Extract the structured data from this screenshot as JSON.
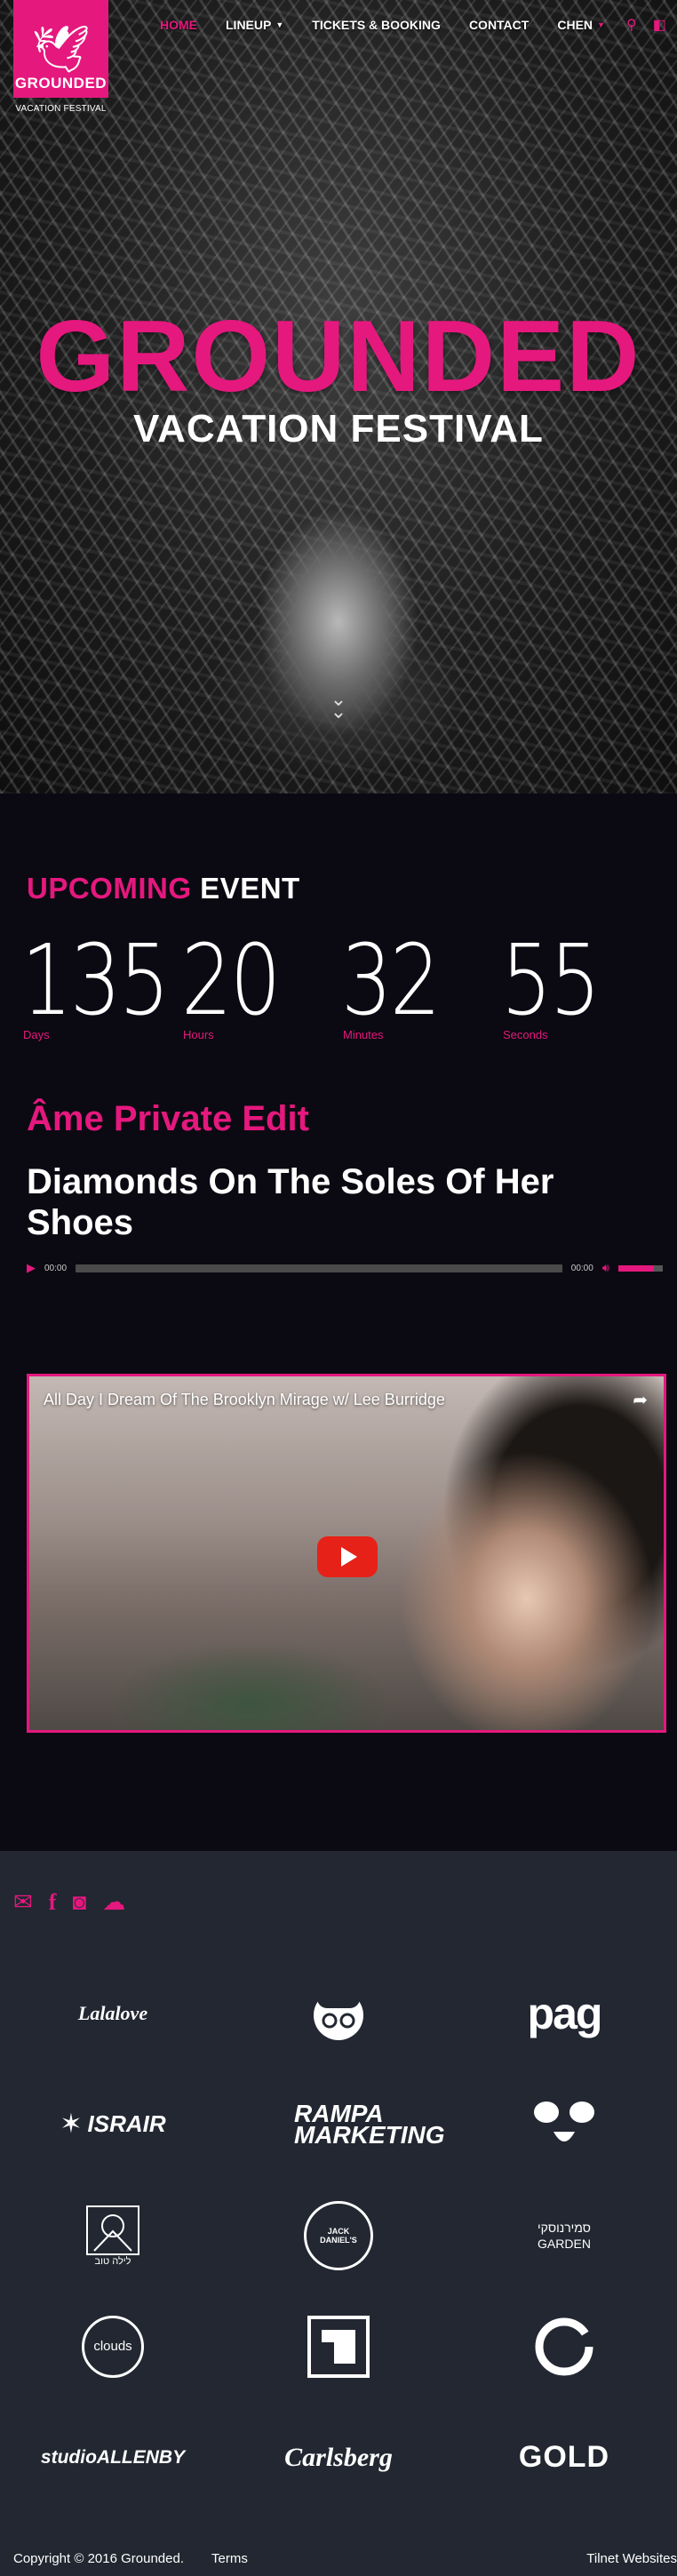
{
  "logo": {
    "text": "GROUNDED",
    "tagline": "VACATION FESTIVAL"
  },
  "nav": {
    "items": [
      {
        "label": "HOME",
        "active": true,
        "dropdown": false
      },
      {
        "label": "LINEUP",
        "active": false,
        "dropdown": true
      },
      {
        "label": "TICKETS & BOOKING",
        "active": false,
        "dropdown": false
      },
      {
        "label": "CONTACT",
        "active": false,
        "dropdown": false
      },
      {
        "label": "CHEN",
        "active": false,
        "dropdown": true
      }
    ],
    "icons": [
      "search-icon",
      "cart-icon"
    ]
  },
  "hero": {
    "title": "GROUNDED",
    "subtitle": "VACATION FESTIVAL"
  },
  "event": {
    "heading_highlight": "UPCOMING",
    "heading_rest": "EVENT",
    "countdown": [
      {
        "value": "135",
        "label": "Days"
      },
      {
        "value": "20",
        "label": "Hours"
      },
      {
        "value": "32",
        "label": "Minutes"
      },
      {
        "value": "55",
        "label": "Seconds"
      }
    ],
    "track_artist": "Âme Private Edit",
    "track_title": "Diamonds On The Soles Of Her Shoes",
    "player": {
      "current_time": "00:00",
      "duration": "00:00",
      "volume": 0.8
    }
  },
  "video": {
    "title": "All Day I Dream Of The Brooklyn Mirage w/ Lee Burridge"
  },
  "footer": {
    "social_icons": [
      "mail-icon",
      "facebook-icon",
      "instagram-icon",
      "soundcloud-icon"
    ],
    "sponsors": [
      "Lalalove",
      "",
      "pag",
      "ISRAIR",
      "RAMPA MARKETING",
      "",
      "לילה טוב",
      "JACK DANIEL'S",
      "סמירנוסקי GARDEN",
      "clouds",
      "",
      "",
      "studioALLENBY",
      "Carlsberg",
      "GOLD"
    ],
    "copyright": "Copyright © 2016 Grounded.",
    "terms": "Terms",
    "credit": "Tilnet Websites"
  },
  "colors": {
    "accent": "#e5187e",
    "background": "#0b0a12",
    "footer_bg": "#222731"
  }
}
